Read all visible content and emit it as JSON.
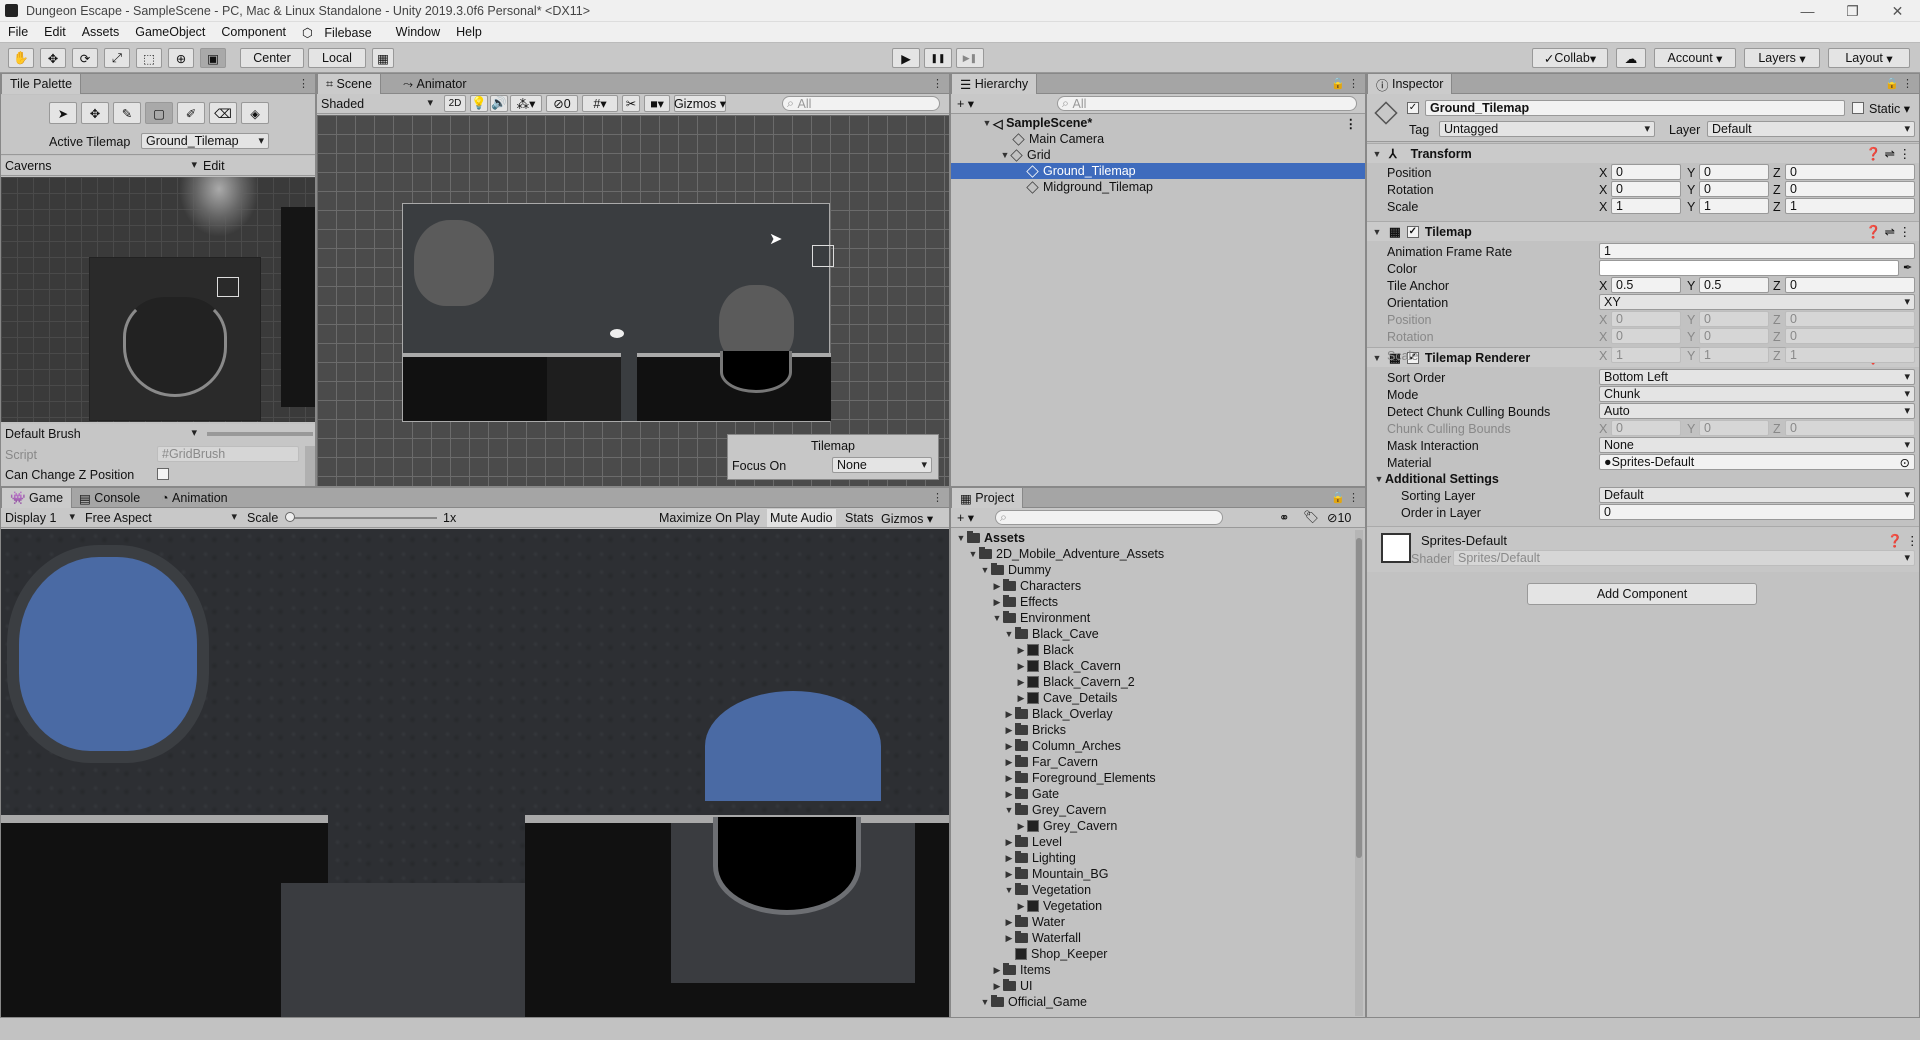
{
  "window": {
    "title": "Dungeon Escape - SampleScene - PC, Mac & Linux Standalone - Unity 2019.3.0f6 Personal* <DX11>",
    "min": "—",
    "max": "❐",
    "close": "✕"
  },
  "menu": [
    "File",
    "Edit",
    "Assets",
    "GameObject",
    "Component",
    "Filebase",
    "Window",
    "Help"
  ],
  "toolbar": {
    "center": "Center",
    "local": "Local",
    "collab": "Collab",
    "account": "Account",
    "layers": "Layers",
    "layout": "Layout",
    "play": "▶",
    "pause": "❚❚",
    "step": "▶❚"
  },
  "tile_palette": {
    "tab": "Tile Palette",
    "active_tilemap_label": "Active Tilemap",
    "active_tilemap": "Ground_Tilemap",
    "palette": "Caverns",
    "edit": "Edit",
    "brush": "Default Brush",
    "script_label": "Script",
    "script_value": "GridBrush",
    "can_change_z": "Can Change Z Position"
  },
  "scene": {
    "tab": "Scene",
    "tab2": "Animator",
    "shading": "Shaded",
    "mode2d": "2D",
    "hidden_count": "0",
    "gizmos": "Gizmos",
    "search_placeholder": "All",
    "overlay_title": "Tilemap",
    "focus_label": "Focus On",
    "focus_value": "None"
  },
  "game": {
    "tab": "Game",
    "tab2": "Console",
    "tab3": "Animation",
    "display": "Display 1",
    "aspect": "Free Aspect",
    "scale_label": "Scale",
    "scale_value": "1x",
    "maximize": "Maximize On Play",
    "mute": "Mute Audio",
    "stats": "Stats",
    "gizmos": "Gizmos"
  },
  "hierarchy": {
    "tab": "Hierarchy",
    "search_placeholder": "All",
    "scene": "SampleScene*",
    "items": [
      "Main Camera",
      "Grid",
      "Ground_Tilemap",
      "Midground_Tilemap"
    ]
  },
  "project": {
    "tab": "Project",
    "badge": "10",
    "tree": [
      {
        "label": "Assets",
        "depth": 0,
        "open": true,
        "bold": true
      },
      {
        "label": "2D_Mobile_Adventure_Assets",
        "depth": 1,
        "open": true
      },
      {
        "label": "Dummy",
        "depth": 2,
        "open": true
      },
      {
        "label": "Characters",
        "depth": 3,
        "open": false
      },
      {
        "label": "Effects",
        "depth": 3,
        "open": false
      },
      {
        "label": "Environment",
        "depth": 3,
        "open": true
      },
      {
        "label": "Black_Cave",
        "depth": 4,
        "open": true
      },
      {
        "label": "Black",
        "depth": 5,
        "asset": true
      },
      {
        "label": "Black_Cavern",
        "depth": 5,
        "asset": true
      },
      {
        "label": "Black_Cavern_2",
        "depth": 5,
        "asset": true
      },
      {
        "label": "Cave_Details",
        "depth": 5,
        "asset": true
      },
      {
        "label": "Black_Overlay",
        "depth": 4,
        "open": false
      },
      {
        "label": "Bricks",
        "depth": 4,
        "open": false
      },
      {
        "label": "Column_Arches",
        "depth": 4,
        "open": false
      },
      {
        "label": "Far_Cavern",
        "depth": 4,
        "open": false
      },
      {
        "label": "Foreground_Elements",
        "depth": 4,
        "open": false
      },
      {
        "label": "Gate",
        "depth": 4,
        "open": false
      },
      {
        "label": "Grey_Cavern",
        "depth": 4,
        "open": true
      },
      {
        "label": "Grey_Cavern",
        "depth": 5,
        "asset": true
      },
      {
        "label": "Level",
        "depth": 4,
        "open": false
      },
      {
        "label": "Lighting",
        "depth": 4,
        "open": false
      },
      {
        "label": "Mountain_BG",
        "depth": 4,
        "open": false
      },
      {
        "label": "Vegetation",
        "depth": 4,
        "open": true
      },
      {
        "label": "Vegetation",
        "depth": 5,
        "asset": true
      },
      {
        "label": "Water",
        "depth": 4,
        "open": false
      },
      {
        "label": "Waterfall",
        "depth": 4,
        "open": false
      },
      {
        "label": "Shop_Keeper",
        "depth": 4,
        "asset": true
      },
      {
        "label": "Items",
        "depth": 3,
        "open": false
      },
      {
        "label": "UI",
        "depth": 3,
        "open": false
      },
      {
        "label": "Official_Game",
        "depth": 2,
        "open": true
      }
    ]
  },
  "inspector": {
    "tab": "Inspector",
    "object_name": "Ground_Tilemap",
    "static": "Static",
    "tag_label": "Tag",
    "tag": "Untagged",
    "layer_label": "Layer",
    "layer": "Default",
    "transform": {
      "title": "Transform",
      "position": "Position",
      "rotation": "Rotation",
      "scale": "Scale",
      "x": "X",
      "y": "Y",
      "z": "Z",
      "pos": [
        "0",
        "0",
        "0"
      ],
      "rot": [
        "0",
        "0",
        "0"
      ],
      "scl": [
        "1",
        "1",
        "1"
      ]
    },
    "tilemap": {
      "title": "Tilemap",
      "frame_rate_label": "Animation Frame Rate",
      "frame_rate": "1",
      "color_label": "Color",
      "anchor_label": "Tile Anchor",
      "anchor": [
        "0.5",
        "0.5",
        "0"
      ],
      "orientation_label": "Orientation",
      "orientation": "XY",
      "position": "Position",
      "rotation": "Rotation",
      "scale": "Scale",
      "pos": [
        "0",
        "0",
        "0"
      ],
      "rot": [
        "0",
        "0",
        "0"
      ],
      "scl": [
        "1",
        "1",
        "1"
      ]
    },
    "renderer": {
      "title": "Tilemap Renderer",
      "sort_order_label": "Sort Order",
      "sort_order": "Bottom Left",
      "mode_label": "Mode",
      "mode": "Chunk",
      "detect_label": "Detect Chunk Culling Bounds",
      "detect": "Auto",
      "bounds_label": "Chunk Culling Bounds",
      "bounds": [
        "0",
        "0",
        "0"
      ],
      "mask_label": "Mask Interaction",
      "mask": "None",
      "material_label": "Material",
      "material": "Sprites-Default",
      "additional": "Additional Settings",
      "sorting_layer_label": "Sorting Layer",
      "sorting_layer": "Default",
      "order_label": "Order in Layer",
      "order": "0"
    },
    "material": {
      "name": "Sprites-Default",
      "shader_label": "Shader",
      "shader": "Sprites/Default"
    },
    "add_component": "Add Component"
  },
  "colors": {
    "selection": "#3e6bbd",
    "panel": "#c2c2c2",
    "tab_active": "#cbcbcb",
    "cave_blue": "#4a6aa4"
  }
}
